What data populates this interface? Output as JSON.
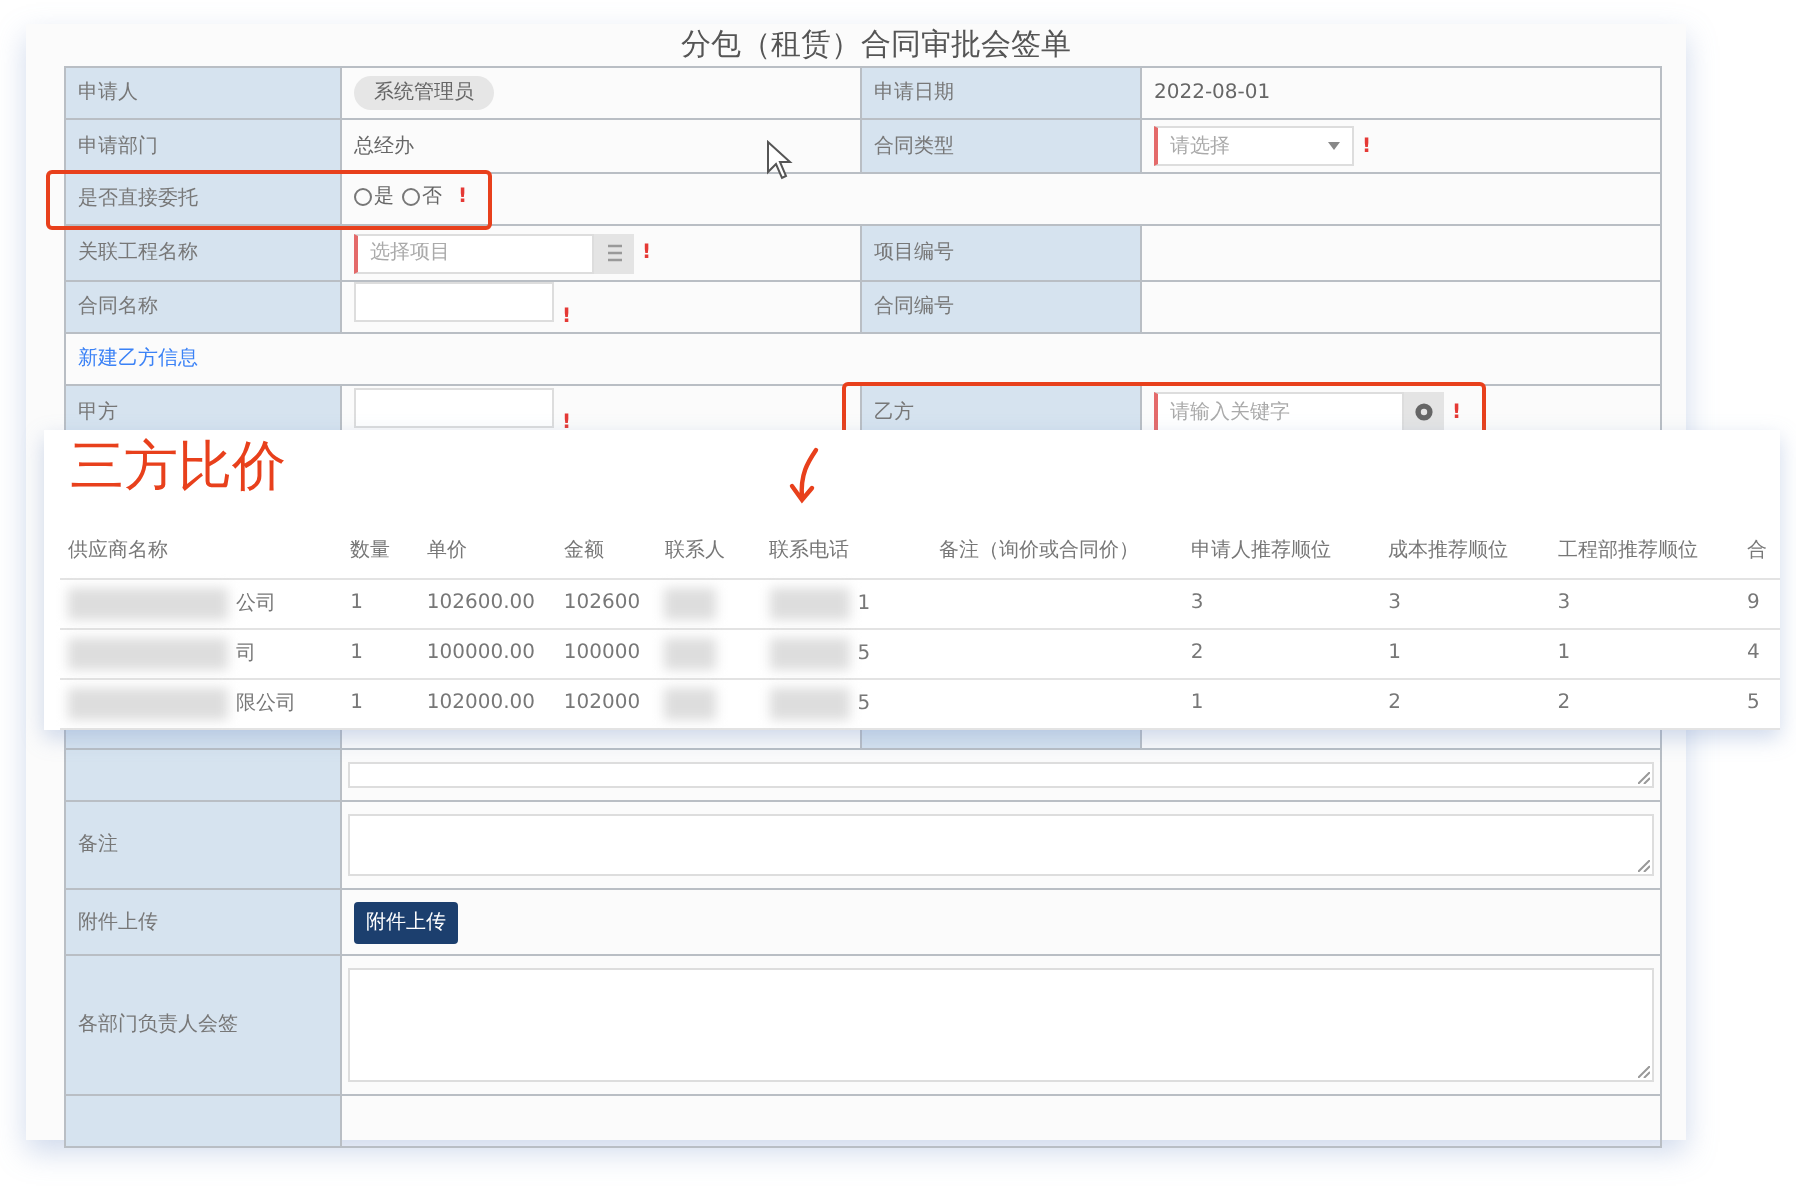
{
  "title": "分包（租赁）合同审批会签单",
  "form": {
    "rows": [
      {
        "cells": [
          {
            "kind": "label",
            "text": "申请人"
          },
          {
            "kind": "chip",
            "text": "系统管理员"
          },
          {
            "kind": "label",
            "text": "申请日期"
          },
          {
            "kind": "text",
            "text": "2022-08-01"
          }
        ]
      },
      {
        "cells": [
          {
            "kind": "label",
            "text": "申请部门"
          },
          {
            "kind": "text",
            "text": "总经办"
          },
          {
            "kind": "label",
            "text": "合同类型"
          },
          {
            "kind": "select",
            "placeholder": "请选择",
            "mark": "!"
          }
        ]
      },
      {
        "cells": [
          {
            "kind": "label",
            "text": "是否直接委托",
            "highlighted": true
          },
          {
            "kind": "radio",
            "options": [
              {
                "label": "是",
                "selected": false
              },
              {
                "label": "否",
                "selected": false
              }
            ],
            "mark": "!",
            "highlighted": true,
            "colspan": 3
          }
        ]
      },
      {
        "cells": [
          {
            "kind": "label",
            "text": "关联工程名称"
          },
          {
            "kind": "lookup",
            "placeholder": "选择项目",
            "mark": "!"
          },
          {
            "kind": "label",
            "text": "项目编号"
          },
          {
            "kind": "empty"
          }
        ]
      },
      {
        "cells": [
          {
            "kind": "label",
            "text": "合同名称"
          },
          {
            "kind": "input",
            "mark": "!"
          },
          {
            "kind": "label",
            "text": "合同编号"
          },
          {
            "kind": "empty"
          }
        ]
      },
      {
        "cells": [
          {
            "kind": "link",
            "text": "新建乙方信息",
            "colspan": 4
          }
        ]
      },
      {
        "cells": [
          {
            "kind": "label",
            "text": "甲方"
          },
          {
            "kind": "input",
            "mark": "!"
          },
          {
            "kind": "label",
            "text": "乙方",
            "highlighted": true
          },
          {
            "kind": "search",
            "placeholder": "请输入关键字",
            "mark": "!",
            "highlighted": true
          }
        ]
      }
    ],
    "lower_rows": [
      {
        "cells": [
          {
            "kind": "blank"
          },
          {
            "kind": "textarea",
            "colspan": 3
          }
        ]
      },
      {
        "cells": [
          {
            "kind": "label",
            "text": "备注"
          },
          {
            "kind": "textarea",
            "colspan": 3
          }
        ]
      },
      {
        "cells": [
          {
            "kind": "label",
            "text": "附件上传"
          },
          {
            "kind": "upload",
            "text": "附件上传",
            "colspan": 3
          }
        ]
      },
      {
        "cells": [
          {
            "kind": "label",
            "text": "各部门负责人会签"
          },
          {
            "kind": "textarea",
            "colspan": 3
          }
        ]
      },
      {
        "cells": [
          {
            "kind": "blank"
          },
          {
            "kind": "empty",
            "colspan": 3
          }
        ]
      }
    ]
  },
  "overlay": {
    "heading": "三方比价",
    "columns": [
      "供应商名称",
      "数量",
      "单价",
      "金额",
      "联系人",
      "联系电话",
      "备注（询价或合同价）",
      "申请人推荐顺位",
      "成本推荐顺位",
      "工程部推荐顺位",
      "合"
    ],
    "rows": [
      {
        "supplier": "公司",
        "qty": "1",
        "unit_price": "102600.00",
        "amount": "102600",
        "phone": "1",
        "rank_applicant": "3",
        "rank_cost": "3",
        "rank_engineering": "3",
        "total": "9"
      },
      {
        "supplier": "司",
        "qty": "1",
        "unit_price": "100000.00",
        "amount": "100000",
        "phone": "5",
        "rank_applicant": "2",
        "rank_cost": "1",
        "rank_engineering": "1",
        "total": "4"
      },
      {
        "supplier": "限公司",
        "qty": "1",
        "unit_price": "102000.00",
        "amount": "102000",
        "phone": "5",
        "rank_applicant": "1",
        "rank_cost": "2",
        "rank_engineering": "2",
        "total": "5"
      }
    ]
  }
}
